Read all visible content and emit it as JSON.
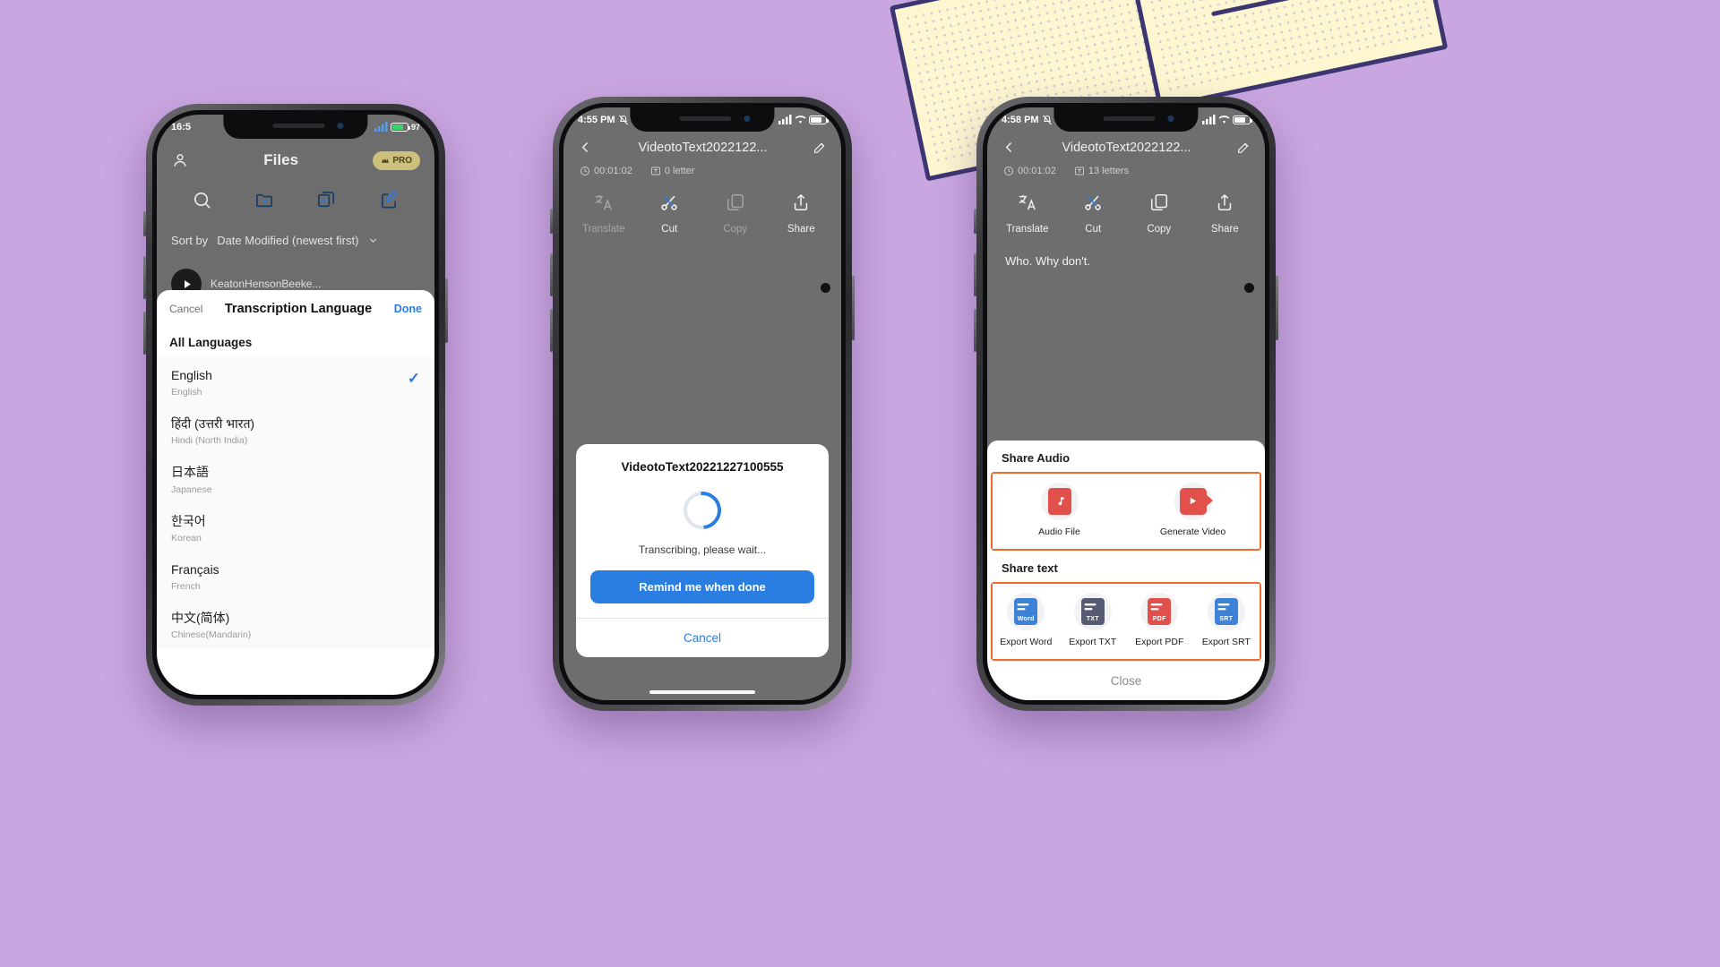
{
  "background_color": "#c9a6e0",
  "accent_orange": "#f06a2a",
  "accent_blue": "#2a7de1",
  "phone1": {
    "status": {
      "time": "16:5",
      "battery": "97"
    },
    "header": {
      "title": "Files",
      "pro_label": "PRO",
      "profile_icon": "person-icon"
    },
    "toolbar_icons": [
      "search-icon",
      "new-folder-icon",
      "select-multiple-icon",
      "edit-note-icon"
    ],
    "sort": {
      "label": "Sort by",
      "value": "Date Modified (newest first)"
    },
    "file_row": {
      "name": "KeatonHensonBeeke...",
      "play_icon": "play-icon"
    },
    "sheet": {
      "cancel": "Cancel",
      "title": "Transcription Language",
      "done": "Done",
      "section": "All Languages",
      "languages": [
        {
          "native": "English",
          "english": "English",
          "selected": true
        },
        {
          "native": "हिंदी (उत्तरी भारत)",
          "english": "Hindi (North India)",
          "selected": false
        },
        {
          "native": "日本語",
          "english": "Japanese",
          "selected": false
        },
        {
          "native": "한국어",
          "english": "Korean",
          "selected": false
        },
        {
          "native": "Français",
          "english": "French",
          "selected": false
        },
        {
          "native": "中文(简体)",
          "english": "Chinese(Mandarin)",
          "selected": false
        }
      ]
    }
  },
  "phone2": {
    "status": {
      "time": "4:55 PM",
      "mute_icon": "bell-off-icon",
      "battery": ""
    },
    "nav": {
      "back_icon": "chevron-left-icon",
      "title": "VideotoText2022122...",
      "edit_icon": "pencil-icon"
    },
    "meta": {
      "duration": "00:01:02",
      "letters": "0 letter",
      "clock_icon": "clock-icon",
      "text_icon": "text-box-icon"
    },
    "tools": [
      {
        "label": "Translate",
        "icon": "translate-icon",
        "disabled": true
      },
      {
        "label": "Cut",
        "icon": "scissors-icon",
        "disabled": false
      },
      {
        "label": "Copy",
        "icon": "copy-icon",
        "disabled": true
      },
      {
        "label": "Share",
        "icon": "share-icon",
        "disabled": false
      }
    ],
    "alert": {
      "title": "VideotoText20221227100555",
      "message": "Transcribing, please wait...",
      "primary_button": "Remind me when done",
      "cancel_button": "Cancel"
    }
  },
  "phone3": {
    "status": {
      "time": "4:58 PM",
      "mute_icon": "bell-off-icon"
    },
    "nav": {
      "back_icon": "chevron-left-icon",
      "title": "VideotoText2022122...",
      "edit_icon": "pencil-icon"
    },
    "meta": {
      "duration": "00:01:02",
      "letters": "13 letters",
      "clock_icon": "clock-icon",
      "text_icon": "text-box-icon"
    },
    "tools": [
      {
        "label": "Translate",
        "icon": "translate-icon",
        "disabled": false
      },
      {
        "label": "Cut",
        "icon": "scissors-icon",
        "disabled": false
      },
      {
        "label": "Copy",
        "icon": "copy-icon",
        "disabled": false
      },
      {
        "label": "Share",
        "icon": "share-icon",
        "disabled": false
      }
    ],
    "transcript": "Who. Why don't.",
    "share_sheet": {
      "audio_label": "Share Audio",
      "audio_items": [
        {
          "caption": "Audio File",
          "icon": "audio-file-icon",
          "color": "#e2504b"
        },
        {
          "caption": "Generate Video",
          "icon": "video-file-icon",
          "color": "#e2504b"
        }
      ],
      "text_label": "Share text",
      "text_items": [
        {
          "caption": "Export Word",
          "icon": "word-file-icon",
          "color": "#3c82d6",
          "badge": "Word"
        },
        {
          "caption": "Export TXT",
          "icon": "txt-file-icon",
          "color": "#545b72",
          "badge": "TXT"
        },
        {
          "caption": "Export PDF",
          "icon": "pdf-file-icon",
          "color": "#e2504b",
          "badge": "PDF"
        },
        {
          "caption": "Export SRT",
          "icon": "srt-file-icon",
          "color": "#3c82d6",
          "badge": "SRT"
        }
      ],
      "close": "Close"
    }
  }
}
